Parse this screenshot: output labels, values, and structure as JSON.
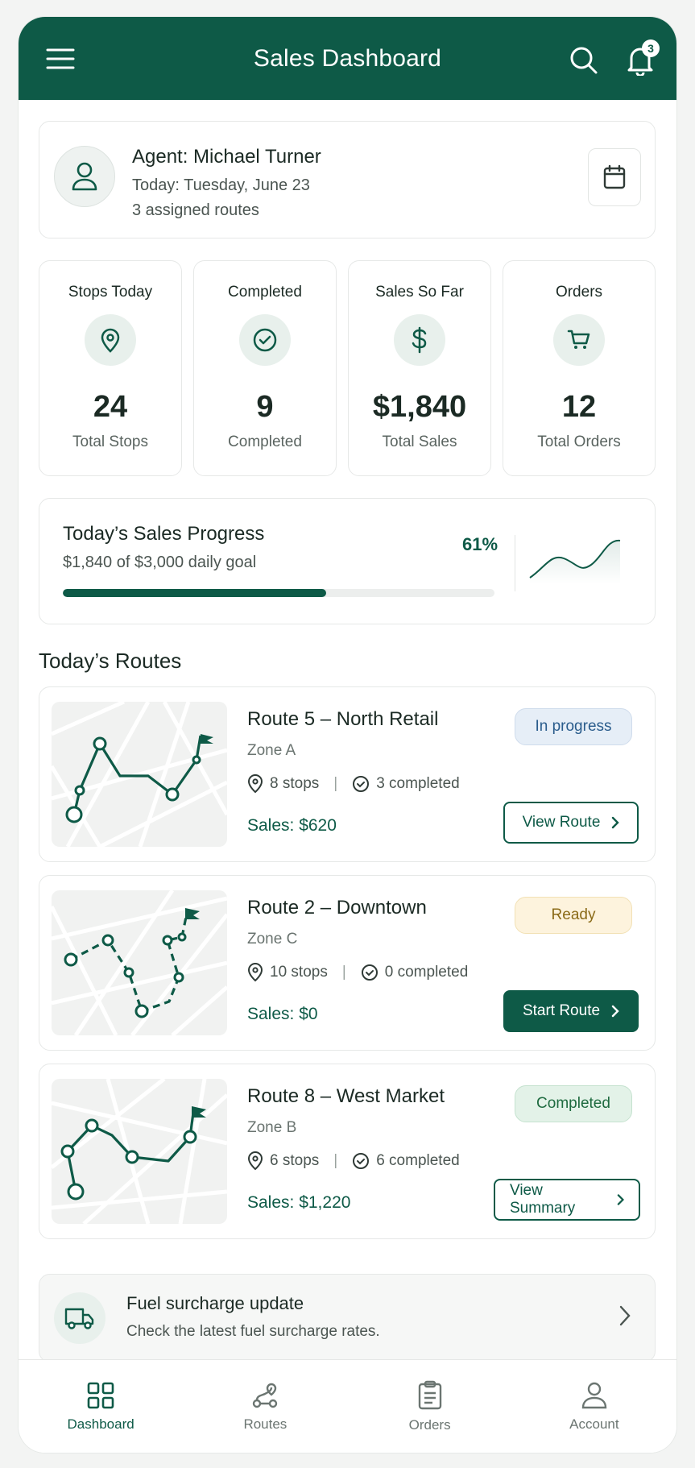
{
  "header": {
    "title": "Sales Dashboard",
    "notification_count": "3"
  },
  "agent": {
    "name": "Agent: Michael Turner",
    "date": "Today: Tuesday, June 23",
    "routes": "3 assigned routes"
  },
  "stats": [
    {
      "label": "Stops Today",
      "value": "24",
      "sub": "Total Stops",
      "icon": "location-pin-icon"
    },
    {
      "label": "Completed",
      "value": "9",
      "sub": "Completed",
      "icon": "check-circle-icon"
    },
    {
      "label": "Sales So Far",
      "value": "$1,840",
      "sub": "Total Sales",
      "icon": "dollar-icon"
    },
    {
      "label": "Orders",
      "value": "12",
      "sub": "Total Orders",
      "icon": "cart-icon"
    }
  ],
  "progress": {
    "title": "Today’s Sales Progress",
    "subtitle": "$1,840 of $3,000 daily goal",
    "percent_label": "61%",
    "fraction": 0.61
  },
  "routes_section": {
    "title": "Today’s Routes"
  },
  "routes": [
    {
      "name": "Route 5 – North Retail",
      "zone": "Zone A",
      "stops": "8 stops",
      "completed": "3 completed",
      "sales": "Sales: $620",
      "status": "In progress",
      "action": "View Route"
    },
    {
      "name": "Route 2 – Downtown",
      "zone": "Zone C",
      "stops": "10 stops",
      "completed": "0 completed",
      "sales": "Sales: $0",
      "status": "Ready",
      "action": "Start Route"
    },
    {
      "name": "Route 8 – West Market",
      "zone": "Zone B",
      "stops": "6 stops",
      "completed": "6 completed",
      "sales": "Sales: $1,220",
      "status": "Completed",
      "action": "View Summary"
    }
  ],
  "banner": {
    "title": "Fuel surcharge update",
    "subtitle": "Check the latest fuel surcharge rates."
  },
  "nav": [
    {
      "label": "Dashboard",
      "icon": "grid-icon",
      "active": true
    },
    {
      "label": "Routes",
      "icon": "route-icon",
      "active": false
    },
    {
      "label": "Orders",
      "icon": "clipboard-icon",
      "active": false
    },
    {
      "label": "Account",
      "icon": "user-icon",
      "active": false
    }
  ],
  "colors": {
    "brand": "#0e5a47",
    "in_progress": "#2a5c8c",
    "ready": "#8a6a17",
    "completed": "#1f6b40"
  }
}
